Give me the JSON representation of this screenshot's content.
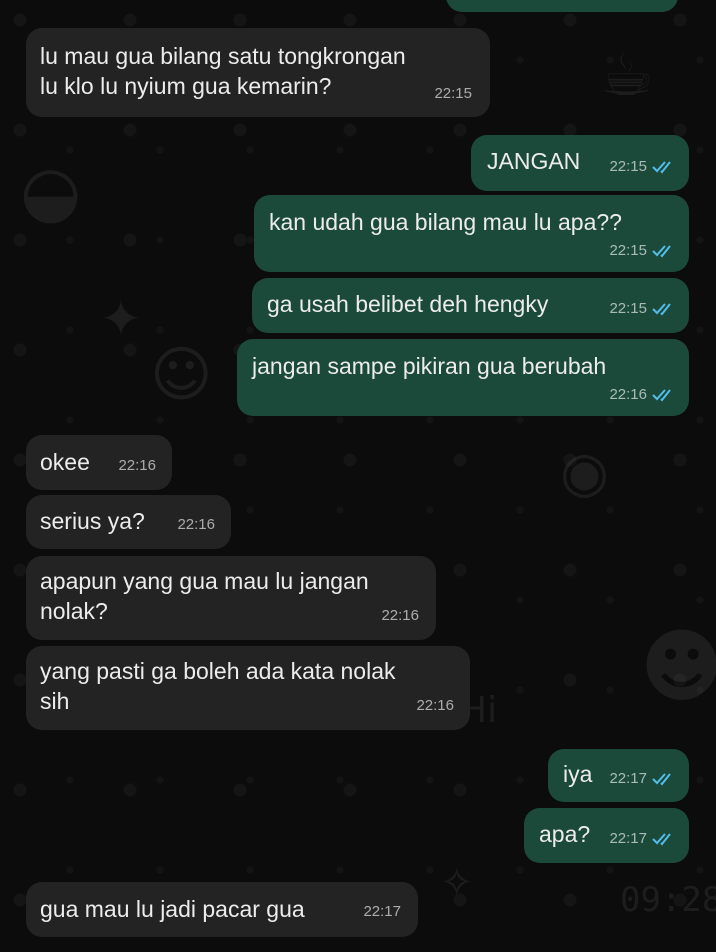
{
  "messages": [
    {
      "from": "incoming",
      "text": "lu mau gua bilang satu tongkrongan\nlu klo lu nyium gua kemarin?",
      "time": "22:15"
    },
    {
      "from": "outgoing",
      "text": "JANGAN",
      "time": "22:15",
      "status": "read-double-check-icon"
    },
    {
      "from": "outgoing",
      "text": "kan udah gua bilang mau lu apa??",
      "time": "22:15",
      "status": "read-double-check-icon"
    },
    {
      "from": "outgoing",
      "text": "ga usah belibet deh hengky",
      "time": "22:15",
      "status": "read-double-check-icon"
    },
    {
      "from": "outgoing",
      "text": "jangan sampe pikiran gua berubah",
      "time": "22:16",
      "status": "read-double-check-icon"
    },
    {
      "from": "incoming",
      "text": "okee",
      "time": "22:16"
    },
    {
      "from": "incoming",
      "text": "serius ya?",
      "time": "22:16"
    },
    {
      "from": "incoming",
      "text": "apapun yang gua mau lu jangan\nnolak?",
      "time": "22:16"
    },
    {
      "from": "incoming",
      "text": "yang pasti ga boleh ada kata nolak\nsih",
      "time": "22:16"
    },
    {
      "from": "outgoing",
      "text": "iya",
      "time": "22:17",
      "status": "read-double-check-icon"
    },
    {
      "from": "outgoing",
      "text": "apa?",
      "time": "22:17",
      "status": "read-double-check-icon"
    },
    {
      "from": "incoming",
      "text": "gua mau lu jadi pacar gua",
      "time": "22:17"
    }
  ],
  "colors": {
    "incoming_bubble": "#232323",
    "outgoing_bubble": "#1c4a3a",
    "read_tick": "#53bdeb",
    "background": "#0b0b0b"
  }
}
